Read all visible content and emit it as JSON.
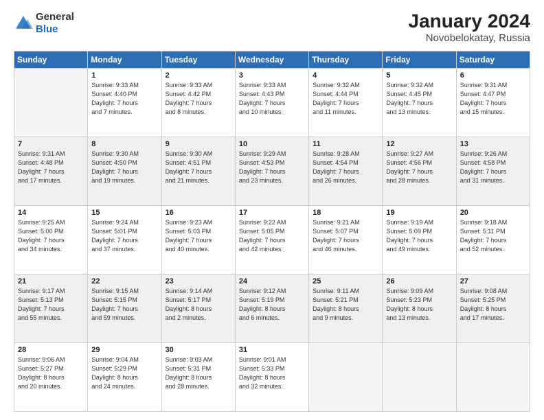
{
  "logo": {
    "general": "General",
    "blue": "Blue"
  },
  "title": "January 2024",
  "location": "Novobelokatay, Russia",
  "days_header": [
    "Sunday",
    "Monday",
    "Tuesday",
    "Wednesday",
    "Thursday",
    "Friday",
    "Saturday"
  ],
  "weeks": [
    [
      {
        "day": "",
        "info": ""
      },
      {
        "day": "1",
        "info": "Sunrise: 9:33 AM\nSunset: 4:40 PM\nDaylight: 7 hours\nand 7 minutes."
      },
      {
        "day": "2",
        "info": "Sunrise: 9:33 AM\nSunset: 4:42 PM\nDaylight: 7 hours\nand 8 minutes."
      },
      {
        "day": "3",
        "info": "Sunrise: 9:33 AM\nSunset: 4:43 PM\nDaylight: 7 hours\nand 10 minutes."
      },
      {
        "day": "4",
        "info": "Sunrise: 9:32 AM\nSunset: 4:44 PM\nDaylight: 7 hours\nand 11 minutes."
      },
      {
        "day": "5",
        "info": "Sunrise: 9:32 AM\nSunset: 4:45 PM\nDaylight: 7 hours\nand 13 minutes."
      },
      {
        "day": "6",
        "info": "Sunrise: 9:31 AM\nSunset: 4:47 PM\nDaylight: 7 hours\nand 15 minutes."
      }
    ],
    [
      {
        "day": "7",
        "info": "Sunrise: 9:31 AM\nSunset: 4:48 PM\nDaylight: 7 hours\nand 17 minutes."
      },
      {
        "day": "8",
        "info": "Sunrise: 9:30 AM\nSunset: 4:50 PM\nDaylight: 7 hours\nand 19 minutes."
      },
      {
        "day": "9",
        "info": "Sunrise: 9:30 AM\nSunset: 4:51 PM\nDaylight: 7 hours\nand 21 minutes."
      },
      {
        "day": "10",
        "info": "Sunrise: 9:29 AM\nSunset: 4:53 PM\nDaylight: 7 hours\nand 23 minutes."
      },
      {
        "day": "11",
        "info": "Sunrise: 9:28 AM\nSunset: 4:54 PM\nDaylight: 7 hours\nand 26 minutes."
      },
      {
        "day": "12",
        "info": "Sunrise: 9:27 AM\nSunset: 4:56 PM\nDaylight: 7 hours\nand 28 minutes."
      },
      {
        "day": "13",
        "info": "Sunrise: 9:26 AM\nSunset: 4:58 PM\nDaylight: 7 hours\nand 31 minutes."
      }
    ],
    [
      {
        "day": "14",
        "info": "Sunrise: 9:25 AM\nSunset: 5:00 PM\nDaylight: 7 hours\nand 34 minutes."
      },
      {
        "day": "15",
        "info": "Sunrise: 9:24 AM\nSunset: 5:01 PM\nDaylight: 7 hours\nand 37 minutes."
      },
      {
        "day": "16",
        "info": "Sunrise: 9:23 AM\nSunset: 5:03 PM\nDaylight: 7 hours\nand 40 minutes."
      },
      {
        "day": "17",
        "info": "Sunrise: 9:22 AM\nSunset: 5:05 PM\nDaylight: 7 hours\nand 42 minutes."
      },
      {
        "day": "18",
        "info": "Sunrise: 9:21 AM\nSunset: 5:07 PM\nDaylight: 7 hours\nand 46 minutes."
      },
      {
        "day": "19",
        "info": "Sunrise: 9:19 AM\nSunset: 5:09 PM\nDaylight: 7 hours\nand 49 minutes."
      },
      {
        "day": "20",
        "info": "Sunrise: 9:18 AM\nSunset: 5:11 PM\nDaylight: 7 hours\nand 52 minutes."
      }
    ],
    [
      {
        "day": "21",
        "info": "Sunrise: 9:17 AM\nSunset: 5:13 PM\nDaylight: 7 hours\nand 55 minutes."
      },
      {
        "day": "22",
        "info": "Sunrise: 9:15 AM\nSunset: 5:15 PM\nDaylight: 7 hours\nand 59 minutes."
      },
      {
        "day": "23",
        "info": "Sunrise: 9:14 AM\nSunset: 5:17 PM\nDaylight: 8 hours\nand 2 minutes."
      },
      {
        "day": "24",
        "info": "Sunrise: 9:12 AM\nSunset: 5:19 PM\nDaylight: 8 hours\nand 6 minutes."
      },
      {
        "day": "25",
        "info": "Sunrise: 9:11 AM\nSunset: 5:21 PM\nDaylight: 8 hours\nand 9 minutes."
      },
      {
        "day": "26",
        "info": "Sunrise: 9:09 AM\nSunset: 5:23 PM\nDaylight: 8 hours\nand 13 minutes."
      },
      {
        "day": "27",
        "info": "Sunrise: 9:08 AM\nSunset: 5:25 PM\nDaylight: 8 hours\nand 17 minutes."
      }
    ],
    [
      {
        "day": "28",
        "info": "Sunrise: 9:06 AM\nSunset: 5:27 PM\nDaylight: 8 hours\nand 20 minutes."
      },
      {
        "day": "29",
        "info": "Sunrise: 9:04 AM\nSunset: 5:29 PM\nDaylight: 8 hours\nand 24 minutes."
      },
      {
        "day": "30",
        "info": "Sunrise: 9:03 AM\nSunset: 5:31 PM\nDaylight: 8 hours\nand 28 minutes."
      },
      {
        "day": "31",
        "info": "Sunrise: 9:01 AM\nSunset: 5:33 PM\nDaylight: 8 hours\nand 32 minutes."
      },
      {
        "day": "",
        "info": ""
      },
      {
        "day": "",
        "info": ""
      },
      {
        "day": "",
        "info": ""
      }
    ]
  ]
}
